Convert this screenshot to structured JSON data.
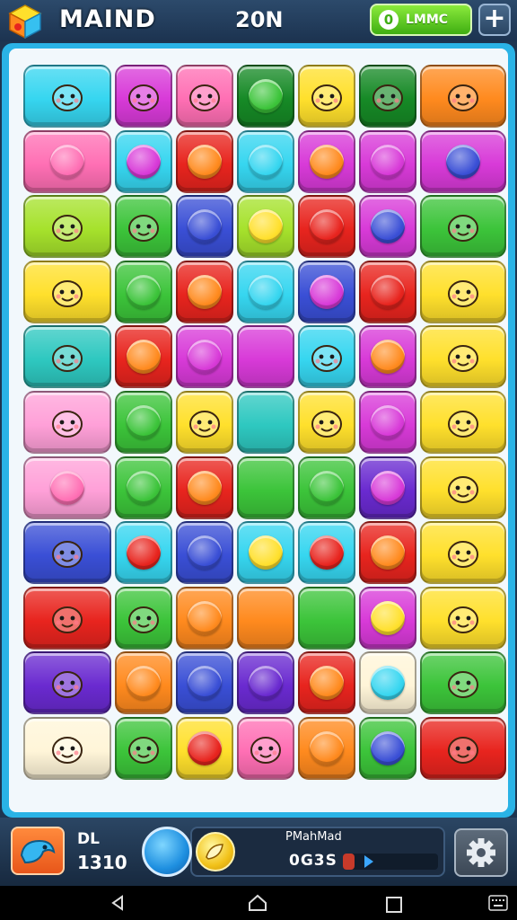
{
  "header": {
    "title": "MAIND",
    "score": "20N",
    "coins": {
      "value": "0",
      "label": "LMMC"
    },
    "add_label": "+"
  },
  "colors": {
    "cyan": "#36d6f0",
    "magenta": "#d83ad8",
    "pink": "#ff6fb4",
    "green": "#3cc43a",
    "darkgreen": "#168a26",
    "yellow": "#ffe02c",
    "orange": "#ff8a1e",
    "red": "#e8241e",
    "blue": "#3a4fd6",
    "purple": "#6a2ad0",
    "lime": "#a6e22c",
    "teal": "#2ec8c0",
    "cream": "#fff5d8",
    "lightpink": "#ffa0d8"
  },
  "board": {
    "columns": 7,
    "rows": 11,
    "tiles": [
      [
        "cyan:creature-smile",
        "magenta:creature-chick",
        "pink:creature-bear",
        "darkgreen:dot-green",
        "yellow:creature-cat",
        "darkgreen:creature-ghost",
        "orange:creature-hamster"
      ],
      [
        "pink:dot-pink",
        "cyan:dot-magenta",
        "red:dot-orange",
        "cyan:dot-cyan",
        "magenta:dot-orange",
        "magenta:dot-magenta",
        "magenta:dot-blue"
      ],
      [
        "lime:creature-ball",
        "green:creature-frog",
        "blue:dot-blue",
        "lime:dot-yellow",
        "red:dot-red",
        "magenta:dot-blue",
        "green:creature-fish"
      ],
      [
        "yellow:creature-bear",
        "green:dot-green",
        "red:dot-orange",
        "cyan:dot-cyan",
        "blue:dot-magenta",
        "red:dot-red",
        "yellow:creature-devil"
      ],
      [
        "teal:creature-fish",
        "red:dot-orange",
        "magenta:dot-magenta",
        "magenta:plain",
        "cyan:creature-sun",
        "magenta:dot-orange",
        "yellow:creature-robot"
      ],
      [
        "lightpink:creature-knight",
        "green:dot-green",
        "yellow:creature-fox",
        "teal:plain",
        "yellow:creature-turtle",
        "magenta:dot-magenta",
        "yellow:creature-key"
      ],
      [
        "lightpink:dot-pink",
        "green:dot-green",
        "red:dot-orange",
        "green:plain",
        "green:dot-green",
        "purple:dot-magenta",
        "yellow:creature-berry"
      ],
      [
        "blue:creature-pan",
        "cyan:dot-red",
        "blue:dot-blue",
        "cyan:dot-yellow",
        "cyan:dot-red",
        "red:dot-orange",
        "yellow:creature-granny"
      ],
      [
        "red:creature-bear",
        "green:creature-swirl",
        "orange:dot-orange",
        "orange:plain",
        "green:plain",
        "magenta:dot-yellow",
        "yellow:creature-apple"
      ],
      [
        "purple:creature-duck",
        "orange:dot-orange",
        "blue:dot-blue",
        "purple:dot-purple",
        "red:dot-orange",
        "cream:dot-cyan",
        "green:creature-cookie"
      ],
      [
        "cream:creature-knight",
        "green:creature-bear",
        "yellow:dot-red",
        "pink:creature-bear",
        "orange:dot-orange",
        "green:dot-blue",
        "red:creature-pepper"
      ]
    ]
  },
  "hud": {
    "level_label": "DL",
    "level_value": "1310",
    "progress_title": "PMahMad",
    "progress_value": "0G3S",
    "progress_fraction": 0.12
  },
  "icons": {
    "logo": "cube-logo-icon",
    "hud_left": "bird-icon",
    "orb": "blue-orb-icon",
    "booster": "lemon-icon",
    "settings": "gear-icon",
    "nav": [
      "back-icon",
      "home-icon",
      "recent-apps-icon",
      "keyboard-icon"
    ]
  }
}
